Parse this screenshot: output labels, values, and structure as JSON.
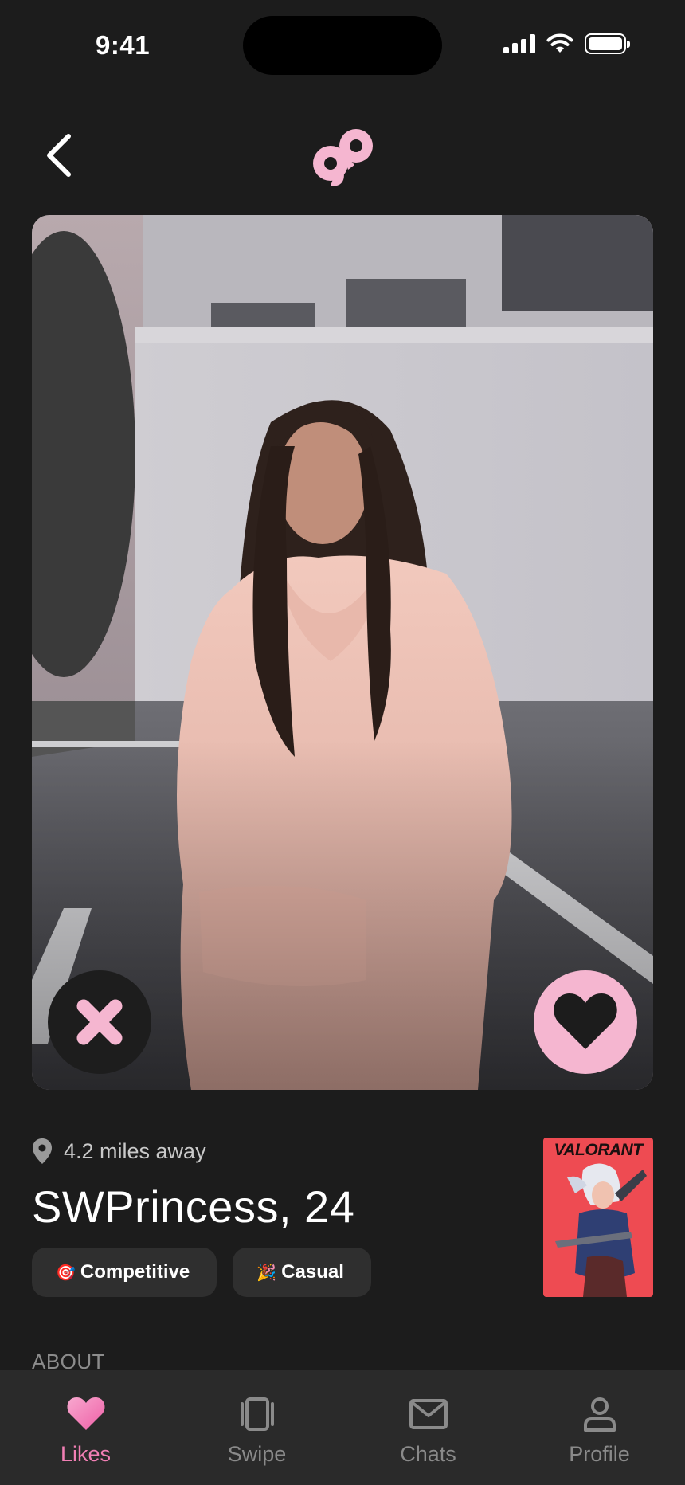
{
  "status_bar": {
    "time": "9:41"
  },
  "header": {
    "back_icon": "chevron-left-icon",
    "logo": "app-logo"
  },
  "profile": {
    "distance": "4.2 miles away",
    "name": "SWPrincess, 24",
    "tags": [
      {
        "emoji": "🎯",
        "label": "Competitive"
      },
      {
        "emoji": "🎉",
        "label": "Casual"
      }
    ],
    "game": {
      "title": "VALORANT"
    }
  },
  "actions": {
    "dislike_icon": "close-icon",
    "like_icon": "heart-icon"
  },
  "sections": {
    "about": "ABOUT"
  },
  "bottom_nav": {
    "items": [
      {
        "label": "Likes",
        "icon": "heart-icon",
        "active": true
      },
      {
        "label": "Swipe",
        "icon": "cards-icon",
        "active": false
      },
      {
        "label": "Chats",
        "icon": "mail-icon",
        "active": false
      },
      {
        "label": "Profile",
        "icon": "person-icon",
        "active": false
      }
    ]
  },
  "colors": {
    "accent": "#f5b6d0",
    "accent_active": "#f17fb4",
    "background": "#1c1c1c",
    "nav_background": "#2a2a2a"
  }
}
